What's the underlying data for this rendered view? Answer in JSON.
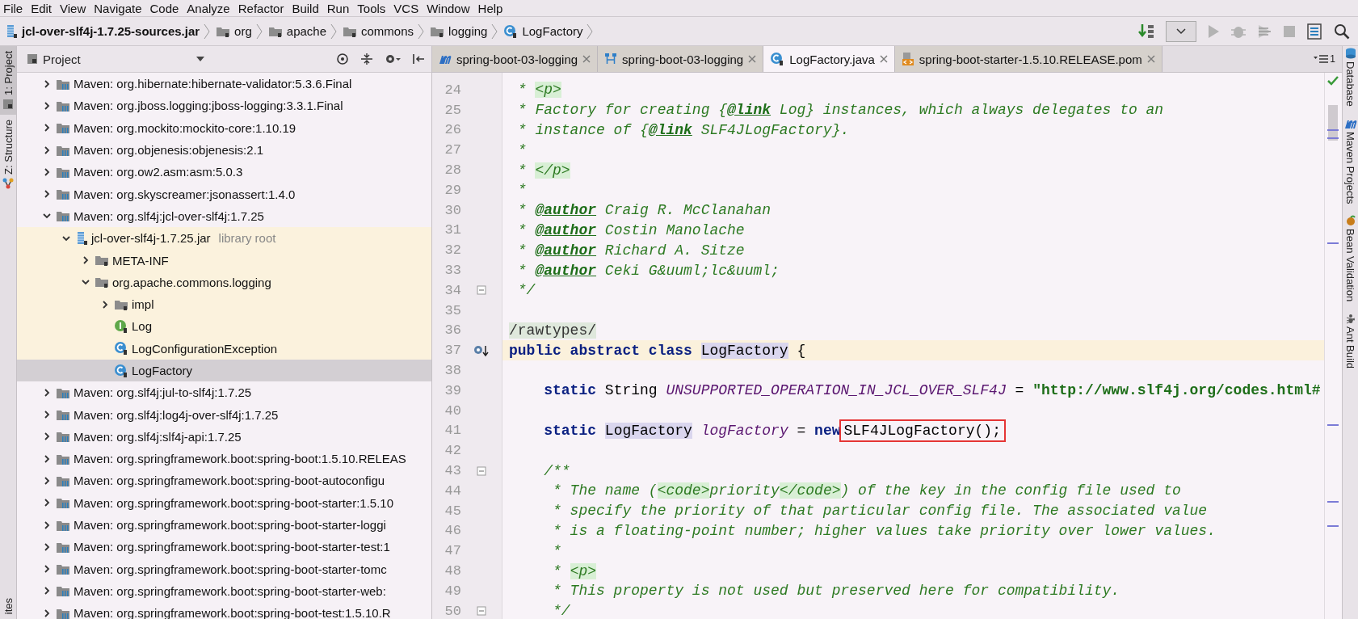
{
  "menu": [
    "File",
    "Edit",
    "View",
    "Navigate",
    "Code",
    "Analyze",
    "Refactor",
    "Build",
    "Run",
    "Tools",
    "VCS",
    "Window",
    "Help"
  ],
  "breadcrumb": [
    {
      "label": "jcl-over-slf4j-1.7.25-sources.jar",
      "kind": "jar"
    },
    {
      "label": "org",
      "kind": "folder"
    },
    {
      "label": "apache",
      "kind": "folder"
    },
    {
      "label": "commons",
      "kind": "folder"
    },
    {
      "label": "logging",
      "kind": "folder"
    },
    {
      "label": "LogFactory",
      "kind": "class"
    }
  ],
  "left_stripe": [
    {
      "label": "1: Project",
      "selected": true,
      "kind": "project"
    },
    {
      "label": "Z: Structure",
      "selected": false,
      "kind": "structure"
    },
    {
      "label": "ites",
      "selected": false,
      "kind": "plain"
    }
  ],
  "project_panel": {
    "title": "Project"
  },
  "tree": [
    {
      "label": "Maven: org.hibernate:hibernate-validator:5.3.6.Final",
      "kind": "library",
      "expanded": false,
      "selected": false
    },
    {
      "label": "Maven: org.jboss.logging:jboss-logging:3.3.1.Final",
      "kind": "library",
      "expanded": false,
      "selected": false
    },
    {
      "label": "Maven: org.mockito:mockito-core:1.10.19",
      "kind": "library",
      "expanded": false,
      "selected": false
    },
    {
      "label": "Maven: org.objenesis:objenesis:2.1",
      "kind": "library",
      "expanded": false,
      "selected": false
    },
    {
      "label": "Maven: org.ow2.asm:asm:5.0.3",
      "kind": "library",
      "expanded": false,
      "selected": false
    },
    {
      "label": "Maven: org.skyscreamer:jsonassert:1.4.0",
      "kind": "library",
      "expanded": false,
      "selected": false
    },
    {
      "label": "Maven: org.slf4j:jcl-over-slf4j:1.7.25",
      "kind": "library",
      "expanded": true,
      "selected": false,
      "children": [
        {
          "label": "jcl-over-slf4j-1.7.25.jar",
          "note": "library root",
          "kind": "jar",
          "expanded": true,
          "selected": false,
          "children": [
            {
              "label": "META-INF",
              "kind": "folder",
              "expanded": false,
              "selected": false
            },
            {
              "label": "org.apache.commons.logging",
              "kind": "folder",
              "expanded": true,
              "selected": false,
              "children": [
                {
                  "label": "impl",
                  "kind": "folder",
                  "expanded": false,
                  "selected": false
                },
                {
                  "label": "Log",
                  "kind": "interface",
                  "selected": false
                },
                {
                  "label": "LogConfigurationException",
                  "kind": "class",
                  "selected": false
                },
                {
                  "label": "LogFactory",
                  "kind": "class",
                  "selected": true
                }
              ]
            }
          ]
        }
      ]
    },
    {
      "label": "Maven: org.slf4j:jul-to-slf4j:1.7.25",
      "kind": "library",
      "expanded": false,
      "selected": false
    },
    {
      "label": "Maven: org.slf4j:log4j-over-slf4j:1.7.25",
      "kind": "library",
      "expanded": false,
      "selected": false
    },
    {
      "label": "Maven: org.slf4j:slf4j-api:1.7.25",
      "kind": "library",
      "expanded": false,
      "selected": false
    },
    {
      "label": "Maven: org.springframework.boot:spring-boot:1.5.10.RELEAS",
      "kind": "library",
      "expanded": false,
      "selected": false
    },
    {
      "label": "Maven: org.springframework.boot:spring-boot-autoconfigu",
      "kind": "library",
      "expanded": false,
      "selected": false
    },
    {
      "label": "Maven: org.springframework.boot:spring-boot-starter:1.5.10",
      "kind": "library",
      "expanded": false,
      "selected": false
    },
    {
      "label": "Maven: org.springframework.boot:spring-boot-starter-loggi",
      "kind": "library",
      "expanded": false,
      "selected": false
    },
    {
      "label": "Maven: org.springframework.boot:spring-boot-starter-test:1",
      "kind": "library",
      "expanded": false,
      "selected": false
    },
    {
      "label": "Maven: org.springframework.boot:spring-boot-starter-tomc",
      "kind": "library",
      "expanded": false,
      "selected": false
    },
    {
      "label": "Maven: org.springframework.boot:spring-boot-starter-web:",
      "kind": "library",
      "expanded": false,
      "selected": false
    },
    {
      "label": "Maven: org.springframework.boot:spring-boot-test:1.5.10.R",
      "kind": "library",
      "expanded": false,
      "selected": false
    }
  ],
  "tabs": [
    {
      "label": "spring-boot-03-logging",
      "kind": "maven",
      "selected": false
    },
    {
      "label": "spring-boot-03-logging",
      "kind": "diagram",
      "selected": false
    },
    {
      "label": "LogFactory.java",
      "kind": "class",
      "selected": true
    },
    {
      "label": "spring-boot-starter-1.5.10.RELEASE.pom",
      "kind": "xml",
      "selected": false
    }
  ],
  "tab_list": "1",
  "code": [
    {
      "number": "24",
      "current": false,
      "fold": false,
      "implemented": false,
      "segments": [
        {
          "kind": "c",
          "text": " * "
        },
        {
          "kind": "tag",
          "text": "<p>"
        }
      ]
    },
    {
      "number": "25",
      "current": false,
      "fold": false,
      "implemented": false,
      "segments": [
        {
          "kind": "c",
          "text": " * Factory for creating {"
        },
        {
          "kind": "doctag",
          "text": "@link"
        },
        {
          "kind": "c",
          "text": " Log} instances, which always delegates to an"
        }
      ]
    },
    {
      "number": "26",
      "current": false,
      "fold": false,
      "implemented": false,
      "segments": [
        {
          "kind": "c",
          "text": " * instance of {"
        },
        {
          "kind": "doctag",
          "text": "@link"
        },
        {
          "kind": "c",
          "text": " SLF4JLogFactory}."
        }
      ]
    },
    {
      "number": "27",
      "current": false,
      "fold": false,
      "implemented": false,
      "segments": [
        {
          "kind": "c",
          "text": " *"
        }
      ]
    },
    {
      "number": "28",
      "current": false,
      "fold": false,
      "implemented": false,
      "segments": [
        {
          "kind": "c",
          "text": " * "
        },
        {
          "kind": "tag",
          "text": "</p>"
        }
      ]
    },
    {
      "number": "29",
      "current": false,
      "fold": false,
      "implemented": false,
      "segments": [
        {
          "kind": "c",
          "text": " *"
        }
      ]
    },
    {
      "number": "30",
      "current": false,
      "fold": false,
      "implemented": false,
      "segments": [
        {
          "kind": "c",
          "text": " * "
        },
        {
          "kind": "doctag",
          "text": "@author"
        },
        {
          "kind": "c",
          "text": " Craig R. McClanahan"
        }
      ]
    },
    {
      "number": "31",
      "current": false,
      "fold": false,
      "implemented": false,
      "segments": [
        {
          "kind": "c",
          "text": " * "
        },
        {
          "kind": "doctag",
          "text": "@author"
        },
        {
          "kind": "c",
          "text": " Costin Manolache"
        }
      ]
    },
    {
      "number": "32",
      "current": false,
      "fold": false,
      "implemented": false,
      "segments": [
        {
          "kind": "c",
          "text": " * "
        },
        {
          "kind": "doctag",
          "text": "@author"
        },
        {
          "kind": "c",
          "text": " Richard A. Sitze"
        }
      ]
    },
    {
      "number": "33",
      "current": false,
      "fold": false,
      "implemented": false,
      "segments": [
        {
          "kind": "c",
          "text": " * "
        },
        {
          "kind": "doctag",
          "text": "@author"
        },
        {
          "kind": "c",
          "text": " Ceki G&uuml;lc&uuml;"
        }
      ]
    },
    {
      "number": "34",
      "current": false,
      "fold": true,
      "implemented": false,
      "segments": [
        {
          "kind": "c",
          "text": " */"
        }
      ]
    },
    {
      "number": "35",
      "current": false,
      "fold": false,
      "implemented": false
    },
    {
      "number": "36",
      "current": false,
      "fold": false,
      "implemented": false,
      "segments": [
        {
          "kind": "annot",
          "text": "/rawtypes/"
        }
      ]
    },
    {
      "number": "37",
      "current": true,
      "fold": false,
      "implemented": true,
      "segments": [
        {
          "kind": "kw",
          "text": "public abstract class "
        },
        {
          "kind": "ref",
          "text": "LogFactory"
        },
        {
          "kind": "plain",
          "text": " {"
        }
      ]
    },
    {
      "number": "38",
      "current": false,
      "fold": false,
      "implemented": false
    },
    {
      "number": "39",
      "current": false,
      "fold": false,
      "implemented": false,
      "segments": [
        {
          "kind": "kw",
          "text": "    static "
        },
        {
          "kind": "plain",
          "text": "String "
        },
        {
          "kind": "field",
          "text": "UNSUPPORTED_OPERATION_IN_JCL_OVER_SLF4J"
        },
        {
          "kind": "plain",
          "text": " = "
        },
        {
          "kind": "str",
          "text": "\"http://www.slf4j.org/codes.html#"
        }
      ]
    },
    {
      "number": "40",
      "current": false,
      "fold": false,
      "implemented": false
    },
    {
      "number": "41",
      "current": false,
      "fold": false,
      "implemented": false,
      "segments": [
        {
          "kind": "kw",
          "text": "    static "
        },
        {
          "kind": "ref",
          "text": "LogFactory"
        },
        {
          "kind": "field",
          "text": " logFactory"
        },
        {
          "kind": "plain",
          "text": " = "
        },
        {
          "kind": "kw",
          "text": "new"
        },
        {
          "kind": "boxed",
          "text": "SLF4JLogFactory();"
        }
      ]
    },
    {
      "number": "42",
      "current": false,
      "fold": false,
      "implemented": false
    },
    {
      "number": "43",
      "current": false,
      "fold": true,
      "implemented": false,
      "segments": [
        {
          "kind": "c",
          "text": "    /**"
        }
      ]
    },
    {
      "number": "44",
      "current": false,
      "fold": false,
      "implemented": false,
      "segments": [
        {
          "kind": "c",
          "text": "     * The name ("
        },
        {
          "kind": "tag",
          "text": "<code>"
        },
        {
          "kind": "c",
          "text": "priority"
        },
        {
          "kind": "tag",
          "text": "</code>"
        },
        {
          "kind": "c",
          "text": ") of the key in the config file used to"
        }
      ]
    },
    {
      "number": "45",
      "current": false,
      "fold": false,
      "implemented": false,
      "segments": [
        {
          "kind": "c",
          "text": "     * specify the priority of that particular config file. The associated value"
        }
      ]
    },
    {
      "number": "46",
      "current": false,
      "fold": false,
      "implemented": false,
      "segments": [
        {
          "kind": "c",
          "text": "     * is a floating-point number; higher values take priority over lower values."
        }
      ]
    },
    {
      "number": "47",
      "current": false,
      "fold": false,
      "implemented": false,
      "segments": [
        {
          "kind": "c",
          "text": "     *"
        }
      ]
    },
    {
      "number": "48",
      "current": false,
      "fold": false,
      "implemented": false,
      "segments": [
        {
          "kind": "c",
          "text": "     * "
        },
        {
          "kind": "tag",
          "text": "<p>"
        }
      ]
    },
    {
      "number": "49",
      "current": false,
      "fold": false,
      "implemented": false,
      "segments": [
        {
          "kind": "c",
          "text": "     * This property is not used but preserved here for compatibility."
        }
      ]
    },
    {
      "number": "50",
      "current": false,
      "fold": true,
      "implemented": false,
      "segments": [
        {
          "kind": "c",
          "text": "     */"
        }
      ]
    }
  ],
  "right_stripe": [
    {
      "label": "Database",
      "kind": "database"
    },
    {
      "label": "Maven Projects",
      "kind": "maven"
    },
    {
      "label": "Bean Validation",
      "kind": "bean"
    },
    {
      "label": "Ant Build",
      "kind": "ant"
    }
  ]
}
